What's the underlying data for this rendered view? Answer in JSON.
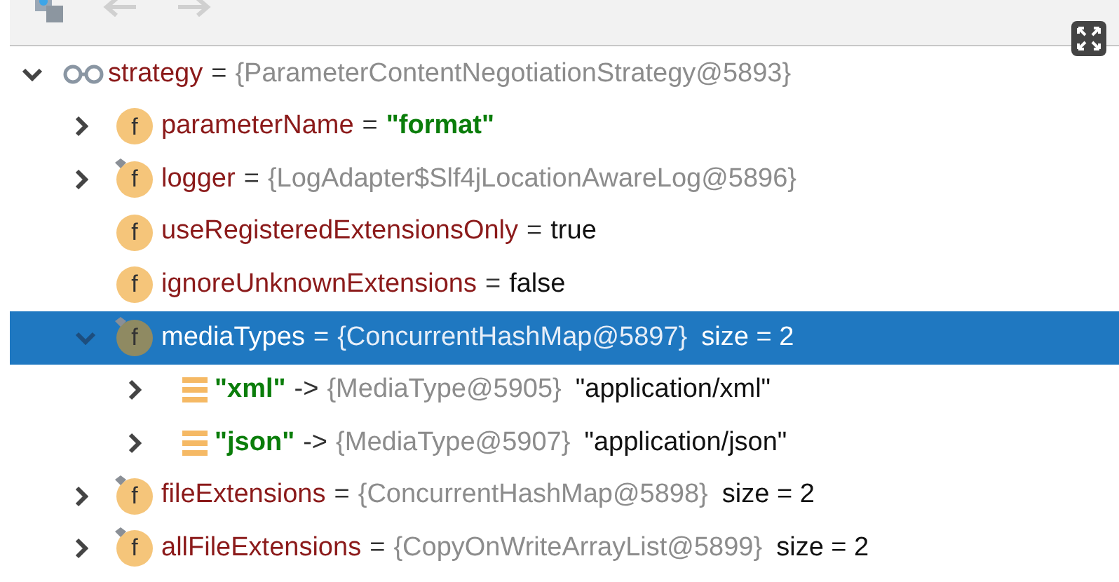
{
  "toolbar": {
    "back_disabled": true,
    "forward_disabled": true
  },
  "tree": [
    {
      "icon": {
        "kind": "watch"
      },
      "expanded": true,
      "selected": false,
      "parts": [
        {
          "kind": "name",
          "text": "strategy"
        },
        {
          "kind": "op",
          "text": "="
        },
        {
          "kind": "ref",
          "text": "{ParameterContentNegotiationStrategy@5893}"
        }
      ],
      "children": [
        {
          "icon": {
            "kind": "field",
            "letter": "f",
            "static": false
          },
          "expanded": false,
          "selected": false,
          "parts": [
            {
              "kind": "name",
              "text": "parameterName"
            },
            {
              "kind": "op",
              "text": "="
            },
            {
              "kind": "string",
              "text": "\"format\""
            }
          ]
        },
        {
          "icon": {
            "kind": "field",
            "letter": "f",
            "static": true
          },
          "expanded": false,
          "selected": false,
          "parts": [
            {
              "kind": "name",
              "text": "logger"
            },
            {
              "kind": "op",
              "text": "="
            },
            {
              "kind": "ref",
              "text": "{LogAdapter$Slf4jLocationAwareLog@5896}"
            }
          ]
        },
        {
          "icon": {
            "kind": "field",
            "letter": "f",
            "static": false
          },
          "selected": false,
          "parts": [
            {
              "kind": "name",
              "text": "useRegisteredExtensionsOnly"
            },
            {
              "kind": "op",
              "text": "="
            },
            {
              "kind": "plain",
              "text": "true"
            }
          ]
        },
        {
          "icon": {
            "kind": "field",
            "letter": "f",
            "static": false
          },
          "selected": false,
          "parts": [
            {
              "kind": "name",
              "text": "ignoreUnknownExtensions"
            },
            {
              "kind": "op",
              "text": "="
            },
            {
              "kind": "plain",
              "text": "false"
            }
          ]
        },
        {
          "icon": {
            "kind": "field",
            "letter": "f",
            "static": true
          },
          "expanded": true,
          "selected": true,
          "parts": [
            {
              "kind": "name",
              "text": "mediaTypes"
            },
            {
              "kind": "op",
              "text": "="
            },
            {
              "kind": "ref",
              "text": "{ConcurrentHashMap@5897}"
            },
            {
              "kind": "plain",
              "text": "size = 2"
            }
          ],
          "children": [
            {
              "icon": {
                "kind": "entry"
              },
              "expanded": false,
              "selected": false,
              "parts": [
                {
                  "kind": "key",
                  "text": "\"xml\""
                },
                {
                  "kind": "op",
                  "text": "->"
                },
                {
                  "kind": "ref",
                  "text": "{MediaType@5905}"
                },
                {
                  "kind": "plain",
                  "text": "\"application/xml\""
                }
              ]
            },
            {
              "icon": {
                "kind": "entry"
              },
              "expanded": false,
              "selected": false,
              "parts": [
                {
                  "kind": "key",
                  "text": "\"json\""
                },
                {
                  "kind": "op",
                  "text": "->"
                },
                {
                  "kind": "ref",
                  "text": "{MediaType@5907}"
                },
                {
                  "kind": "plain",
                  "text": "\"application/json\""
                }
              ]
            }
          ]
        },
        {
          "icon": {
            "kind": "field",
            "letter": "f",
            "static": true
          },
          "expanded": false,
          "selected": false,
          "parts": [
            {
              "kind": "name",
              "text": "fileExtensions"
            },
            {
              "kind": "op",
              "text": "="
            },
            {
              "kind": "ref",
              "text": "{ConcurrentHashMap@5898}"
            },
            {
              "kind": "plain",
              "text": "size = 2"
            }
          ]
        },
        {
          "icon": {
            "kind": "field",
            "letter": "f",
            "static": true
          },
          "expanded": false,
          "selected": false,
          "parts": [
            {
              "kind": "name",
              "text": "allFileExtensions"
            },
            {
              "kind": "op",
              "text": "="
            },
            {
              "kind": "ref",
              "text": "{CopyOnWriteArrayList@5899}"
            },
            {
              "kind": "plain",
              "text": "size = 2"
            }
          ]
        }
      ]
    }
  ]
}
